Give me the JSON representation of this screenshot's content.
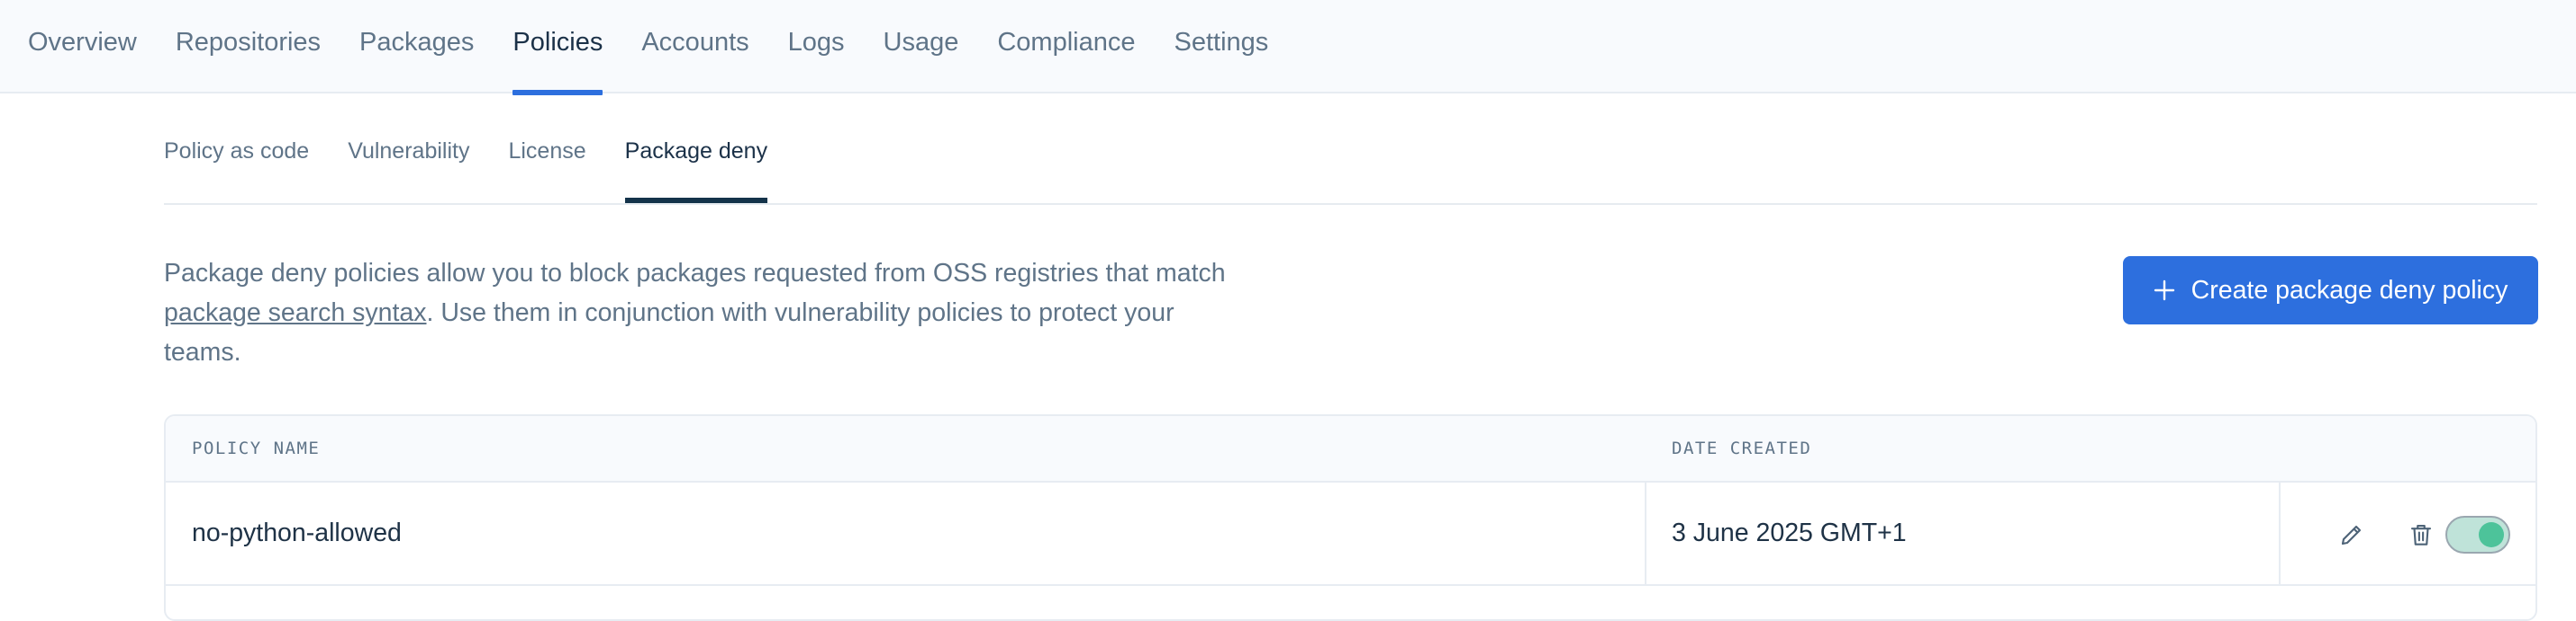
{
  "top_nav": {
    "items": [
      {
        "label": "Overview"
      },
      {
        "label": "Repositories"
      },
      {
        "label": "Packages"
      },
      {
        "label": "Policies",
        "active": true
      },
      {
        "label": "Accounts"
      },
      {
        "label": "Logs"
      },
      {
        "label": "Usage"
      },
      {
        "label": "Compliance"
      },
      {
        "label": "Settings"
      }
    ]
  },
  "sub_tabs": {
    "items": [
      {
        "label": "Policy as code"
      },
      {
        "label": "Vulnerability"
      },
      {
        "label": "License"
      },
      {
        "label": "Package deny",
        "active": true
      }
    ]
  },
  "description": {
    "text_before": "Package deny policies allow you to block packages requested from OSS registries that match ",
    "link": "package search syntax",
    "text_after": ". Use them in conjunction with vulnerability policies to protect your teams."
  },
  "create_button": {
    "label": "Create package deny policy",
    "icon": "plus-icon"
  },
  "table": {
    "columns": [
      "POLICY NAME",
      "DATE CREATED"
    ],
    "rows": [
      {
        "name": "no-python-allowed",
        "date_created": "3 June 2025 GMT+1",
        "actions": [
          "pencil-icon",
          "trash-icon"
        ],
        "enabled": true
      }
    ]
  },
  "colors": {
    "accent": "#2d6fde",
    "active_subtab": "#14334a",
    "toggle_on": "#4dc39a"
  }
}
